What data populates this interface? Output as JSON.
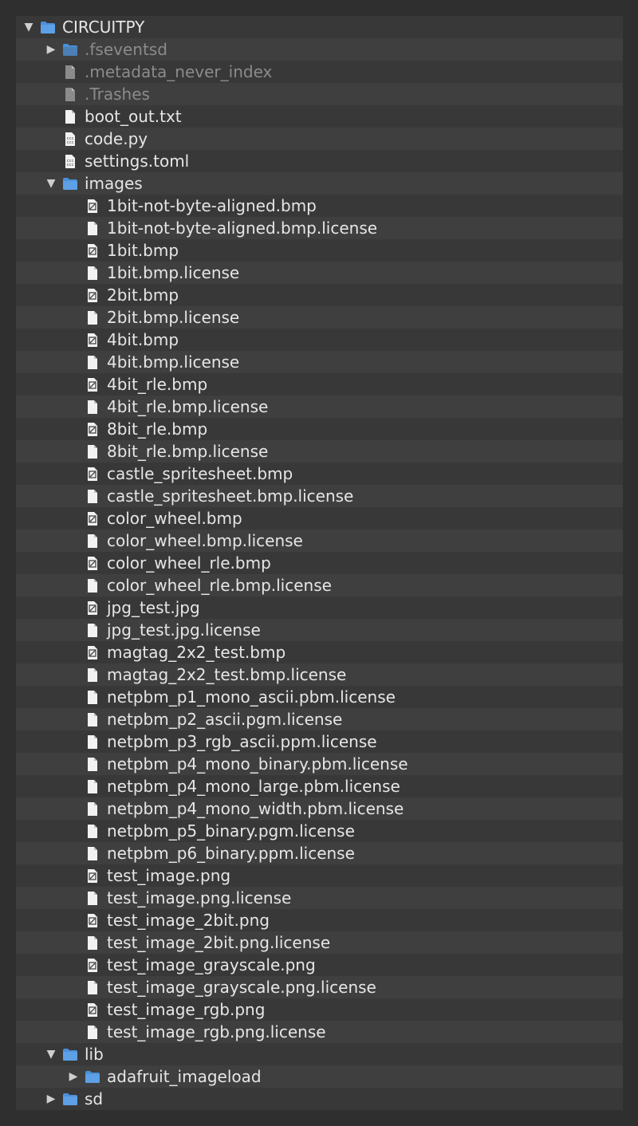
{
  "colors": {
    "background": "#2f2f2f",
    "row": "#383838",
    "row_alt": "#3f3f3f",
    "text": "#e6e6e6",
    "text_dimmed": "#8b8b8b",
    "folder_blue": "#4a90d9",
    "file_icon": "#f2f2f2"
  },
  "tree": [
    {
      "label": "CIRCUITPY",
      "depth": 0,
      "icon": "folder-icon",
      "expander": "expanded-arrow-icon",
      "dimmed": false
    },
    {
      "label": ".fseventsd",
      "depth": 1,
      "icon": "folder-icon",
      "expander": "collapsed-arrow-icon",
      "dimmed": true
    },
    {
      "label": ".metadata_never_index",
      "depth": 1,
      "icon": "file-icon",
      "expander": "",
      "dimmed": true
    },
    {
      "label": ".Trashes",
      "depth": 1,
      "icon": "file-icon",
      "expander": "",
      "dimmed": true
    },
    {
      "label": "boot_out.txt",
      "depth": 1,
      "icon": "file-icon",
      "expander": "",
      "dimmed": false
    },
    {
      "label": "code.py",
      "depth": 1,
      "icon": "code-file-icon",
      "expander": "",
      "dimmed": false
    },
    {
      "label": "settings.toml",
      "depth": 1,
      "icon": "code-file-icon",
      "expander": "",
      "dimmed": false
    },
    {
      "label": "images",
      "depth": 1,
      "icon": "folder-icon",
      "expander": "expanded-arrow-icon",
      "dimmed": false
    },
    {
      "label": "1bit-not-byte-aligned.bmp",
      "depth": 2,
      "icon": "image-file-icon",
      "expander": "",
      "dimmed": false
    },
    {
      "label": "1bit-not-byte-aligned.bmp.license",
      "depth": 2,
      "icon": "file-icon",
      "expander": "",
      "dimmed": false
    },
    {
      "label": "1bit.bmp",
      "depth": 2,
      "icon": "image-file-icon",
      "expander": "",
      "dimmed": false
    },
    {
      "label": "1bit.bmp.license",
      "depth": 2,
      "icon": "file-icon",
      "expander": "",
      "dimmed": false
    },
    {
      "label": "2bit.bmp",
      "depth": 2,
      "icon": "image-file-icon",
      "expander": "",
      "dimmed": false
    },
    {
      "label": "2bit.bmp.license",
      "depth": 2,
      "icon": "file-icon",
      "expander": "",
      "dimmed": false
    },
    {
      "label": "4bit.bmp",
      "depth": 2,
      "icon": "image-file-icon",
      "expander": "",
      "dimmed": false
    },
    {
      "label": "4bit.bmp.license",
      "depth": 2,
      "icon": "file-icon",
      "expander": "",
      "dimmed": false
    },
    {
      "label": "4bit_rle.bmp",
      "depth": 2,
      "icon": "image-file-icon",
      "expander": "",
      "dimmed": false
    },
    {
      "label": "4bit_rle.bmp.license",
      "depth": 2,
      "icon": "file-icon",
      "expander": "",
      "dimmed": false
    },
    {
      "label": "8bit_rle.bmp",
      "depth": 2,
      "icon": "image-file-icon",
      "expander": "",
      "dimmed": false
    },
    {
      "label": "8bit_rle.bmp.license",
      "depth": 2,
      "icon": "file-icon",
      "expander": "",
      "dimmed": false
    },
    {
      "label": "castle_spritesheet.bmp",
      "depth": 2,
      "icon": "image-file-icon",
      "expander": "",
      "dimmed": false
    },
    {
      "label": "castle_spritesheet.bmp.license",
      "depth": 2,
      "icon": "file-icon",
      "expander": "",
      "dimmed": false
    },
    {
      "label": "color_wheel.bmp",
      "depth": 2,
      "icon": "image-file-icon",
      "expander": "",
      "dimmed": false
    },
    {
      "label": "color_wheel.bmp.license",
      "depth": 2,
      "icon": "file-icon",
      "expander": "",
      "dimmed": false
    },
    {
      "label": "color_wheel_rle.bmp",
      "depth": 2,
      "icon": "image-file-icon",
      "expander": "",
      "dimmed": false
    },
    {
      "label": "color_wheel_rle.bmp.license",
      "depth": 2,
      "icon": "file-icon",
      "expander": "",
      "dimmed": false
    },
    {
      "label": "jpg_test.jpg",
      "depth": 2,
      "icon": "image-file-icon",
      "expander": "",
      "dimmed": false
    },
    {
      "label": "jpg_test.jpg.license",
      "depth": 2,
      "icon": "file-icon",
      "expander": "",
      "dimmed": false
    },
    {
      "label": "magtag_2x2_test.bmp",
      "depth": 2,
      "icon": "image-file-icon",
      "expander": "",
      "dimmed": false
    },
    {
      "label": "magtag_2x2_test.bmp.license",
      "depth": 2,
      "icon": "file-icon",
      "expander": "",
      "dimmed": false
    },
    {
      "label": "netpbm_p1_mono_ascii.pbm.license",
      "depth": 2,
      "icon": "file-icon",
      "expander": "",
      "dimmed": false
    },
    {
      "label": "netpbm_p2_ascii.pgm.license",
      "depth": 2,
      "icon": "file-icon",
      "expander": "",
      "dimmed": false
    },
    {
      "label": "netpbm_p3_rgb_ascii.ppm.license",
      "depth": 2,
      "icon": "file-icon",
      "expander": "",
      "dimmed": false
    },
    {
      "label": "netpbm_p4_mono_binary.pbm.license",
      "depth": 2,
      "icon": "file-icon",
      "expander": "",
      "dimmed": false
    },
    {
      "label": "netpbm_p4_mono_large.pbm.license",
      "depth": 2,
      "icon": "file-icon",
      "expander": "",
      "dimmed": false
    },
    {
      "label": "netpbm_p4_mono_width.pbm.license",
      "depth": 2,
      "icon": "file-icon",
      "expander": "",
      "dimmed": false
    },
    {
      "label": "netpbm_p5_binary.pgm.license",
      "depth": 2,
      "icon": "file-icon",
      "expander": "",
      "dimmed": false
    },
    {
      "label": "netpbm_p6_binary.ppm.license",
      "depth": 2,
      "icon": "file-icon",
      "expander": "",
      "dimmed": false
    },
    {
      "label": "test_image.png",
      "depth": 2,
      "icon": "image-file-icon",
      "expander": "",
      "dimmed": false
    },
    {
      "label": "test_image.png.license",
      "depth": 2,
      "icon": "file-icon",
      "expander": "",
      "dimmed": false
    },
    {
      "label": "test_image_2bit.png",
      "depth": 2,
      "icon": "image-file-icon",
      "expander": "",
      "dimmed": false
    },
    {
      "label": "test_image_2bit.png.license",
      "depth": 2,
      "icon": "file-icon",
      "expander": "",
      "dimmed": false
    },
    {
      "label": "test_image_grayscale.png",
      "depth": 2,
      "icon": "image-file-icon",
      "expander": "",
      "dimmed": false
    },
    {
      "label": "test_image_grayscale.png.license",
      "depth": 2,
      "icon": "file-icon",
      "expander": "",
      "dimmed": false
    },
    {
      "label": "test_image_rgb.png",
      "depth": 2,
      "icon": "image-file-icon",
      "expander": "",
      "dimmed": false
    },
    {
      "label": "test_image_rgb.png.license",
      "depth": 2,
      "icon": "file-icon",
      "expander": "",
      "dimmed": false
    },
    {
      "label": "lib",
      "depth": 1,
      "icon": "folder-icon",
      "expander": "expanded-arrow-icon",
      "dimmed": false
    },
    {
      "label": "adafruit_imageload",
      "depth": 2,
      "icon": "folder-icon",
      "expander": "collapsed-arrow-icon",
      "dimmed": false
    },
    {
      "label": "sd",
      "depth": 1,
      "icon": "folder-icon",
      "expander": "collapsed-arrow-icon",
      "dimmed": false
    }
  ]
}
